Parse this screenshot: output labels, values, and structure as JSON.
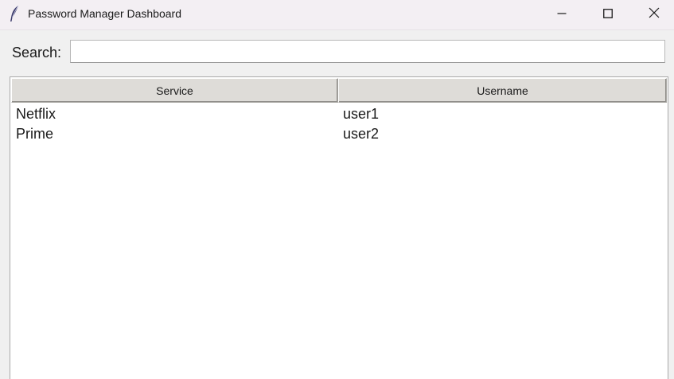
{
  "window": {
    "title": "Password Manager Dashboard",
    "icon": "feather-icon"
  },
  "controls": {
    "minimize_icon": "minimize-icon",
    "maximize_icon": "maximize-icon",
    "close_icon": "close-icon"
  },
  "search": {
    "label": "Search:",
    "value": "",
    "placeholder": ""
  },
  "table": {
    "columns": [
      "Service",
      "Username"
    ],
    "rows": [
      {
        "service": "Netflix",
        "username": "user1"
      },
      {
        "service": "Prime",
        "username": "user2"
      }
    ]
  },
  "colors": {
    "titlebar_bg": "#f3eff3",
    "window_bg": "#f0f0f0",
    "header_bg": "#dedcd8",
    "list_bg": "#ffffff"
  }
}
